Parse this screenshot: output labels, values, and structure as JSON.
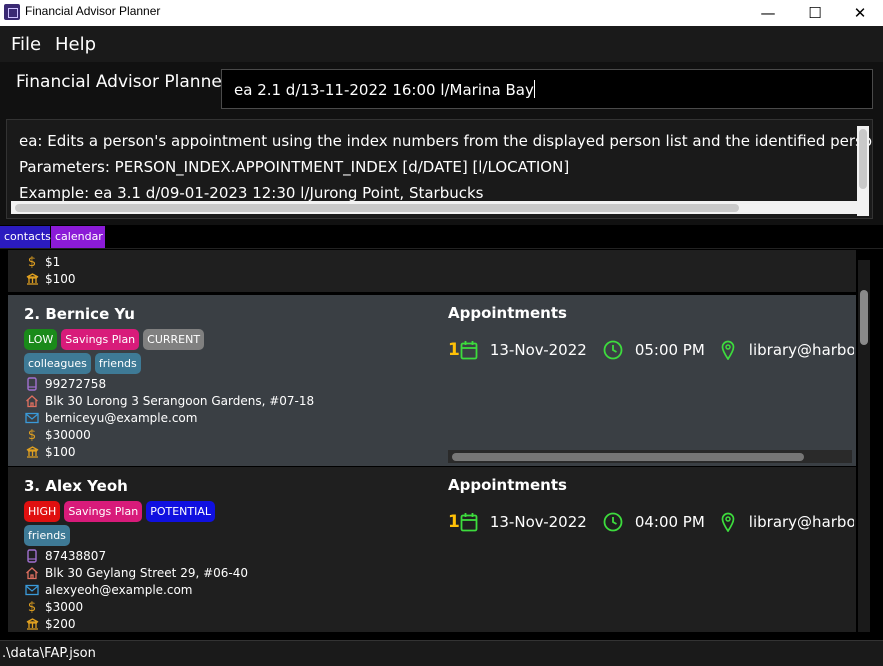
{
  "window": {
    "title": "Financial Advisor Planner",
    "controls": {
      "minimize": "—",
      "maximize": "☐",
      "close": "✕"
    }
  },
  "menu": {
    "file": "File",
    "help": "Help"
  },
  "command": {
    "label": "Financial Advisor Planner",
    "value": "ea 2.1 d/13-11-2022 16:00 l/Marina Bay"
  },
  "result": {
    "lines": [
      "ea: Edits a person's appointment using the index numbers from the displayed person list and the identified person's",
      "Parameters: PERSON_INDEX.APPOINTMENT_INDEX [d/DATE] [l/LOCATION]",
      "Example: ea 3.1 d/09-01-2023 12:30 l/Jurong Point, Starbucks"
    ]
  },
  "tabs": {
    "contacts": "contacts",
    "calendar": "calendar"
  },
  "partial_card": {
    "income": "$1",
    "premium": "$100"
  },
  "persons": [
    {
      "index_name": "2.  Bernice Yu",
      "tags_row1": [
        {
          "text": "LOW",
          "color": "#1a8a1a"
        },
        {
          "text": "Savings Plan",
          "color": "#d81b7a"
        },
        {
          "text": "CURRENT",
          "color": "#808080"
        }
      ],
      "tags_row2": [
        {
          "text": "colleagues",
          "color": "#3e7a96"
        },
        {
          "text": "friends",
          "color": "#3e7a96"
        }
      ],
      "phone": "99272758",
      "address": "Blk 30 Lorong 3 Serangoon Gardens, #07-18",
      "email": "berniceyu@example.com",
      "income": "$30000",
      "premium": "$100",
      "appointments_title": "Appointments",
      "appointment": {
        "index": "1",
        "date": "13-Nov-2022",
        "time": "05:00 PM",
        "location": "library@harbourfront"
      }
    },
    {
      "index_name": "3.  Alex Yeoh",
      "tags_row1": [
        {
          "text": "HIGH",
          "color": "#e01010"
        },
        {
          "text": "Savings Plan",
          "color": "#d81b7a"
        },
        {
          "text": "POTENTIAL",
          "color": "#1010e0"
        }
      ],
      "tags_row2": [
        {
          "text": "friends",
          "color": "#3e7a96"
        }
      ],
      "phone": "87438807",
      "address": "Blk 30 Geylang Street 29, #06-40",
      "email": "alexyeoh@example.com",
      "income": "$3000",
      "premium": "$200",
      "appointments_title": "Appointments",
      "appointment": {
        "index": "1",
        "date": "13-Nov-2022",
        "time": "04:00 PM",
        "location": "library@harbourfront"
      }
    }
  ],
  "status": {
    "path": ".\\data\\FAP.json"
  },
  "colors": {
    "icon_green": "#3ddc3d",
    "index_yellow": "#ffc107",
    "phone_purple": "#a070d0",
    "home_red": "#e07060",
    "mail_blue": "#3a9ad9",
    "money_yellow": "#e0a020"
  },
  "icons": [
    "phone-icon",
    "home-icon",
    "email-icon",
    "dollar-icon",
    "bank-icon",
    "calendar-icon",
    "clock-icon",
    "location-pin-icon"
  ]
}
